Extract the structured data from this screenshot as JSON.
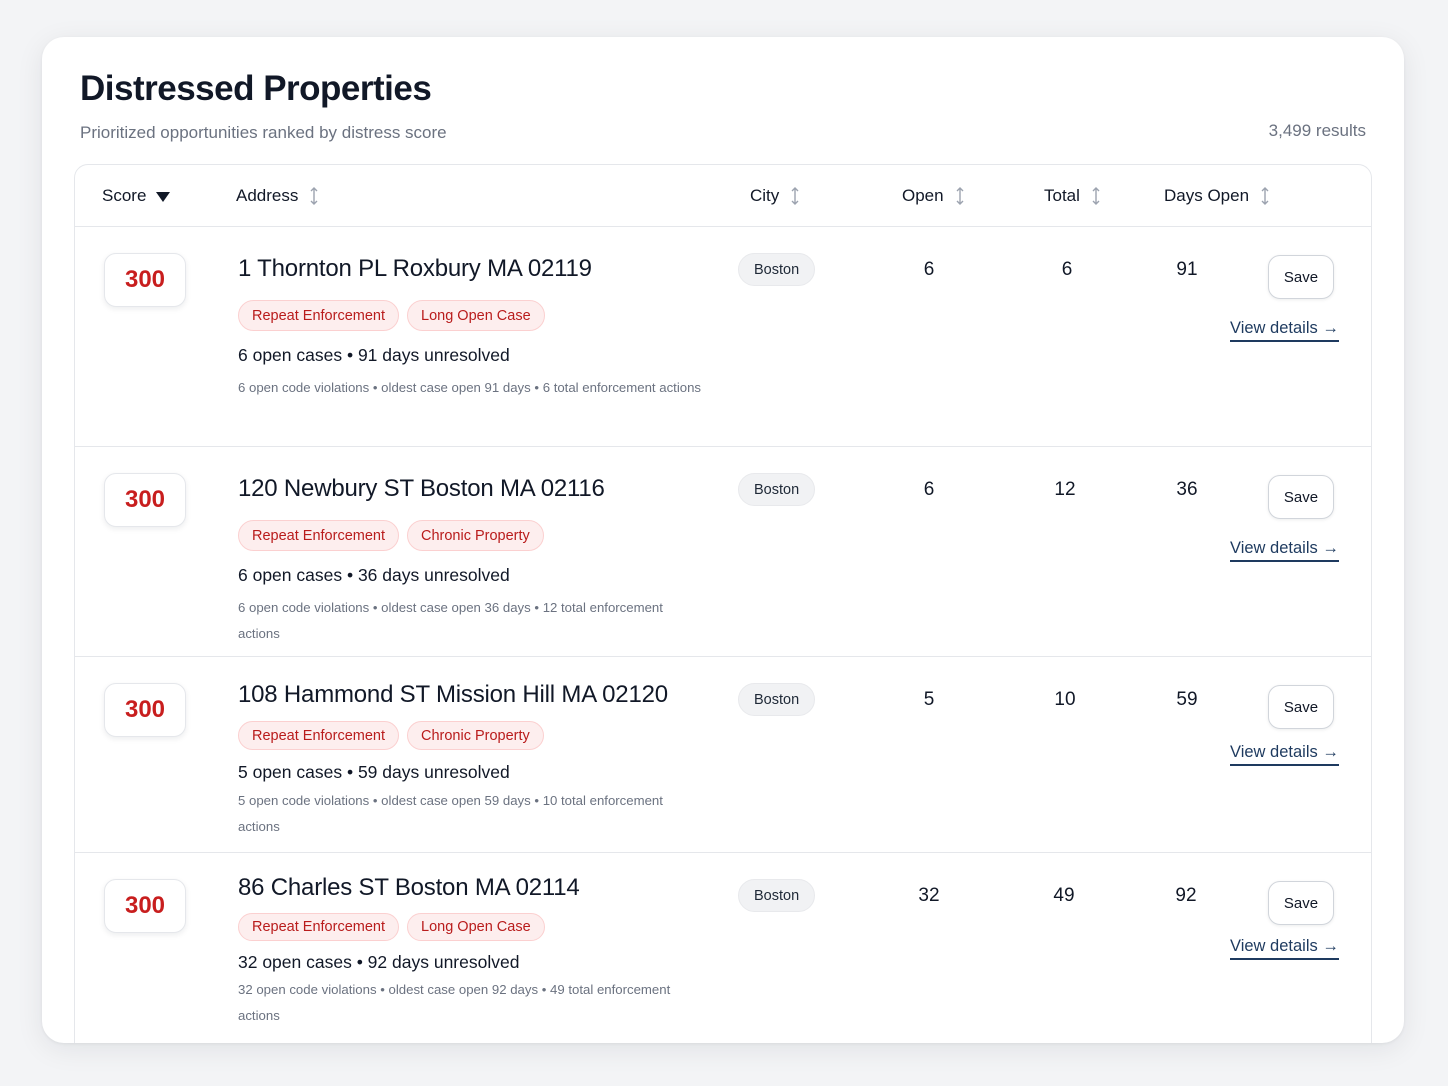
{
  "header": {
    "title": "Distressed Properties",
    "subtitle": "Prioritized opportunities ranked by distress score",
    "results": "3,499 results"
  },
  "columns": {
    "score": "Score",
    "address": "Address",
    "city": "City",
    "open": "Open",
    "total": "Total",
    "days_open": "Days Open"
  },
  "icons": {
    "score_sort": "caret-down-icon",
    "other_sort": "sort-updown-icon",
    "link_arrow": "arrow-right-icon"
  },
  "rows": [
    {
      "score": "300",
      "address": "1 Thornton PL Roxbury MA 02119",
      "tags": [
        "Repeat Enforcement",
        "Long Open Case"
      ],
      "summary": "6 open cases  •  91 days unresolved",
      "detail": "6 open code violations • oldest case open 91 days • 6 total enforcement actions",
      "city": "Boston",
      "open": "6",
      "total": "6",
      "days_open": "91",
      "save_label": "Save",
      "view_label": "View details →"
    },
    {
      "score": "300",
      "address": "120 Newbury ST Boston MA 02116",
      "tags": [
        "Repeat Enforcement",
        "Chronic Property"
      ],
      "summary": "6 open cases  •  36 days unresolved",
      "detail": "6 open code violations • oldest case open 36 days • 12 total enforcement actions",
      "city": "Boston",
      "open": "6",
      "total": "12",
      "days_open": "36",
      "save_label": "Save",
      "view_label": "View details →"
    },
    {
      "score": "300",
      "address": "108 Hammond ST Mission Hill MA 02120",
      "tags": [
        "Repeat Enforcement",
        "Chronic Property"
      ],
      "summary": "5 open cases  •  59 days unresolved",
      "detail": "5 open code violations • oldest case open 59 days • 10 total enforcement actions",
      "city": "Boston",
      "open": "5",
      "total": "10",
      "days_open": "59",
      "save_label": "Save",
      "view_label": "View details →"
    },
    {
      "score": "300",
      "address": "86 Charles ST Boston MA 02114",
      "tags": [
        "Repeat Enforcement",
        "Long Open Case"
      ],
      "summary": "32 open cases  •  92 days unresolved",
      "detail": "32 open code violations • oldest case open 92 days • 49 total enforcement actions",
      "city": "Boston",
      "open": "32",
      "total": "49",
      "days_open": "92",
      "save_label": "Save",
      "view_label": "View details →"
    }
  ]
}
